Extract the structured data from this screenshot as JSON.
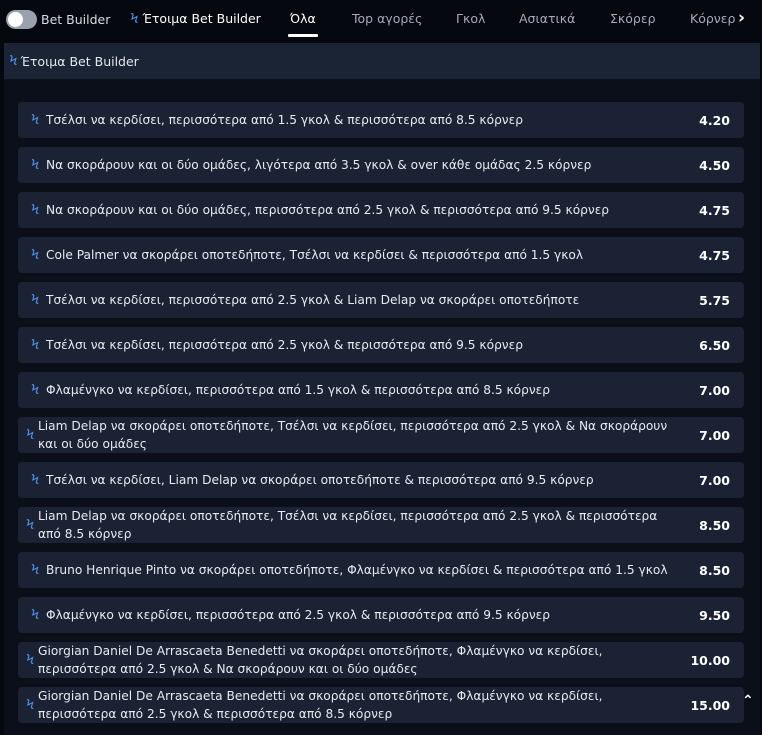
{
  "topbar": {
    "toggle_label": "Bet Builder",
    "tabs": [
      {
        "label": "Έτοιμα Bet Builder"
      },
      {
        "label": "Όλα"
      },
      {
        "label": "Top αγορές"
      },
      {
        "label": "Γκολ"
      },
      {
        "label": "Ασιατικά"
      },
      {
        "label": "Σκόρερ"
      },
      {
        "label": "Κόρνερ"
      }
    ],
    "active_tab": "Όλα"
  },
  "section": {
    "title": "Έτοιμα Bet Builder"
  },
  "bets": [
    {
      "desc": "Τσέλσι να κερδίσει, περισσότερα από 1.5 γκολ & περισσότερα από 8.5 κόρνερ",
      "odds": "4.20"
    },
    {
      "desc": "Να σκοράρουν και οι δύο ομάδες, λιγότερα από 3.5 γκολ & over κάθε ομάδας 2.5 κόρνερ",
      "odds": "4.50"
    },
    {
      "desc": "Να σκοράρουν και οι δύο ομάδες, περισσότερα από 2.5 γκολ & περισσότερα από 9.5 κόρνερ",
      "odds": "4.75"
    },
    {
      "desc": "Cole Palmer να σκοράρει οποτεδήποτε, Τσέλσι να κερδίσει & περισσότερα από 1.5 γκολ",
      "odds": "4.75"
    },
    {
      "desc": "Τσέλσι να κερδίσει, περισσότερα από 2.5 γκολ & Liam Delap να σκοράρει οποτεδήποτε",
      "odds": "5.75"
    },
    {
      "desc": "Τσέλσι να κερδίσει, περισσότερα από 2.5 γκολ & περισσότερα από 9.5 κόρνερ",
      "odds": "6.50"
    },
    {
      "desc": "Φλαμένγκο να κερδίσει, περισσότερα από 1.5 γκολ & περισσότερα από 8.5 κόρνερ",
      "odds": "7.00"
    },
    {
      "desc": "Liam Delap να σκοράρει οποτεδήποτε, Τσέλσι να κερδίσει, περισσότερα από 2.5 γκολ & Να σκοράρουν και οι δύο ομάδες",
      "odds": "7.00"
    },
    {
      "desc": "Τσέλσι να κερδίσει, Liam Delap να σκοράρει οποτεδήποτε & περισσότερα από 9.5 κόρνερ",
      "odds": "7.00"
    },
    {
      "desc": "Liam Delap να σκοράρει οποτεδήποτε, Τσέλσι να κερδίσει, περισσότερα από 2.5 γκολ & περισσότερα από 8.5 κόρνερ",
      "odds": "8.50"
    },
    {
      "desc": "Bruno Henrique Pinto να σκοράρει οποτεδήποτε, Φλαμένγκο να κερδίσει & περισσότερα από 1.5 γκολ",
      "odds": "8.50"
    },
    {
      "desc": "Φλαμένγκο να κερδίσει, περισσότερα από 2.5 γκολ & περισσότερα από 9.5 κόρνερ",
      "odds": "9.50"
    },
    {
      "desc": "Giorgian Daniel De Arrascaeta Benedetti να σκοράρει οποτεδήποτε, Φλαμένγκο να κερδίσει, περισσότερα από 2.5 γκολ & Να σκοράρουν και οι δύο ομάδες",
      "odds": "10.00"
    },
    {
      "desc": "Giorgian Daniel De Arrascaeta Benedetti να σκοράρει οποτεδήποτε, Φλαμένγκο να κερδίσει, περισσότερα από 2.5 γκολ & περισσότερα από 8.5 κόρνερ",
      "odds": "15.00"
    }
  ],
  "icons": {
    "bolt": "lightning-bolt-icon",
    "next": "chevron-right-icon",
    "scroll_top": "chevron-up-icon"
  },
  "colors": {
    "accent": "#4f8fe8",
    "row_bg": "#1a2233",
    "page_bg": "#06080f"
  }
}
